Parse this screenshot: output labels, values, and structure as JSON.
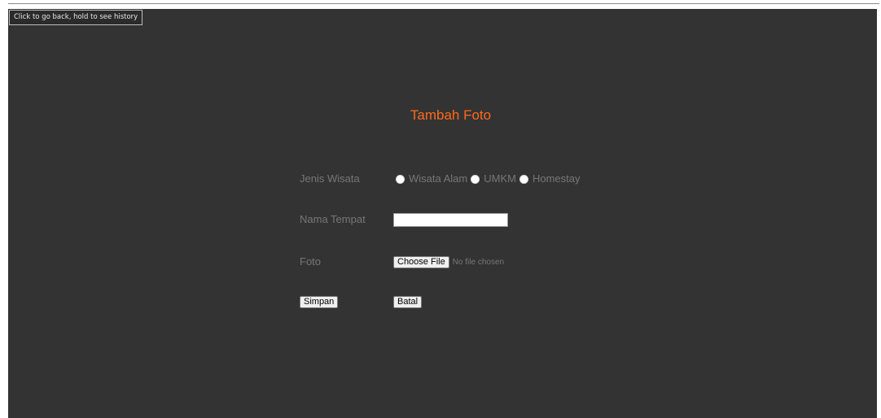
{
  "tooltip": {
    "text": "Click to go back, hold to see history"
  },
  "form": {
    "title": "Tambah Foto",
    "jenis_label": "Jenis Wisata",
    "jenis_options": [
      "Wisata Alam",
      "UMKM",
      "Homestay"
    ],
    "nama_label": "Nama Tempat",
    "nama_value": "",
    "foto_label": "Foto",
    "choose_file_label": "Choose File",
    "file_status": "No file chosen",
    "simpan_label": "Simpan",
    "batal_label": "Batal"
  },
  "colors": {
    "page_background": "#333333",
    "title": "#ff6a1a",
    "label": "#777777"
  },
  "icons": [
    "radio-icon"
  ]
}
